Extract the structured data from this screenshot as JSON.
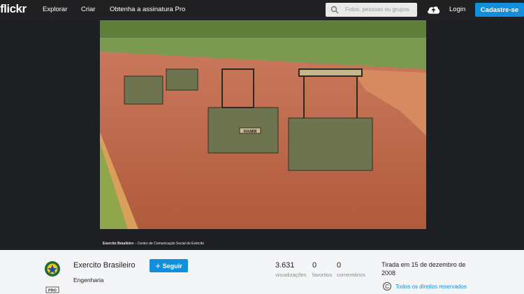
{
  "header": {
    "logo": "flickr",
    "nav": [
      "Explorar",
      "Criar",
      "Obtenha a assinatura Pro"
    ],
    "search_placeholder": "Fotos, pessoas ou grupos",
    "login": "Login",
    "signup": "Cadastre-se"
  },
  "photo": {
    "caption_author": "Exercito Brasileiro",
    "caption_credit": " – Centro de Comunicação Social do Exército",
    "roller_label": "HAMM"
  },
  "author": {
    "name": "Exercito Brasileiro",
    "follow": "Seguir",
    "subtitle": "Engenharia",
    "badge": "PRO"
  },
  "stats": [
    {
      "value": "3.631",
      "label": "visualizações"
    },
    {
      "value": "0",
      "label": "favoritos"
    },
    {
      "value": "0",
      "label": "comentários"
    }
  ],
  "taken": "Tirada em 15 de dezembro de 2008",
  "rights": {
    "symbol": "C",
    "text": "Todos os direitos reservados"
  },
  "colors": {
    "accent": "#128fdc",
    "topbar": "#212124",
    "stage": "#1e1f22"
  }
}
